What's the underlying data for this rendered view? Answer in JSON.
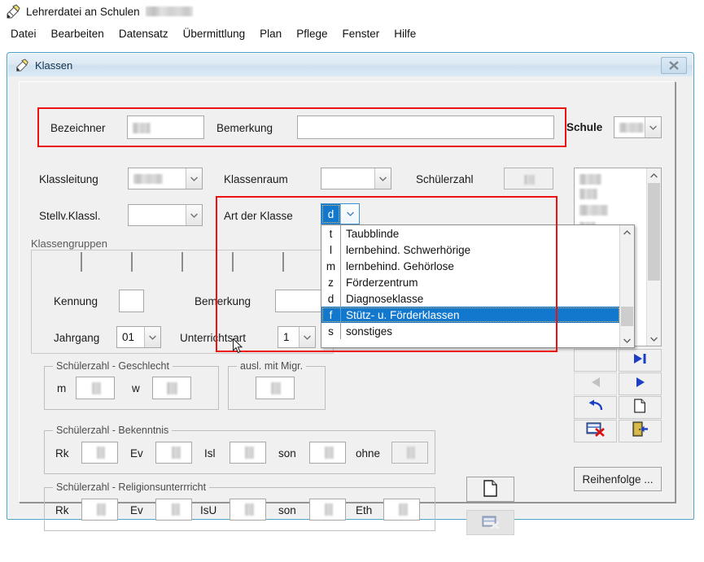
{
  "app": {
    "icon": "pen-document-icon",
    "title": "Lehrerdatei an Schulen",
    "title_redacted": true,
    "menu": [
      "Datei",
      "Bearbeiten",
      "Datensatz",
      "Übermittlung",
      "Plan",
      "Pflege",
      "Fenster",
      "Hilfe"
    ]
  },
  "dialog": {
    "icon": "pen-document-icon",
    "title": "Klassen",
    "close_label": "✕"
  },
  "top_section": {
    "bezeichner_label": "Bezeichner",
    "bezeichner_value": "",
    "bemerkung_label": "Bemerkung",
    "bemerkung_value": "",
    "schule_label": "Schule",
    "schule_value": ""
  },
  "form": {
    "klassleitung_label": "Klassleitung",
    "klassleitung_value": "",
    "klassenraum_label": "Klassenraum",
    "klassenraum_value": "",
    "schuelerzahl_label": "Schülerzahl",
    "schuelerzahl_value": "",
    "stellv_label": "Stellv.Klassl.",
    "stellv_value": "",
    "art_der_klasse_label": "Art der Klasse",
    "art_der_klasse_value": "d"
  },
  "klassengruppen": {
    "title": "Klassengruppen",
    "kennung_label": "Kennung",
    "kennung_value": "",
    "bemerkung_label": "Bemerkung",
    "bemerkung_value": "",
    "jahrgang_label": "Jahrgang",
    "jahrgang_value": "01",
    "unterrichtsart_label": "Unterrichtsart",
    "unterrichtsart_value": "1"
  },
  "geschlecht": {
    "title": "Schülerzahl - Geschlecht",
    "m_label": "m",
    "m_value": "",
    "w_label": "w",
    "w_value": ""
  },
  "migration": {
    "title": "ausl. mit Migr.",
    "value": ""
  },
  "bekenntnis": {
    "title": "Schülerzahl - Bekenntnis",
    "fields": [
      {
        "label": "Rk",
        "value": ""
      },
      {
        "label": "Ev",
        "value": ""
      },
      {
        "label": "Isl",
        "value": ""
      },
      {
        "label": "son",
        "value": ""
      },
      {
        "label": "ohne",
        "value": ""
      }
    ]
  },
  "religionsunterricht": {
    "title": "Schülerzahl - Religionsunterrricht",
    "fields": [
      {
        "label": "Rk",
        "value": ""
      },
      {
        "label": "Ev",
        "value": ""
      },
      {
        "label": "IsU",
        "value": ""
      },
      {
        "label": "son",
        "value": ""
      },
      {
        "label": "Eth",
        "value": ""
      }
    ]
  },
  "art_der_klasse_dropdown": {
    "open": true,
    "selected_key": "f",
    "highlight_color": "#1278ce",
    "options": [
      {
        "key": "t",
        "label": "Taubblinde"
      },
      {
        "key": "l",
        "label": "lernbehind. Schwerhörige"
      },
      {
        "key": "m",
        "label": "lernbehind. Gehörlose"
      },
      {
        "key": "z",
        "label": "Förderzentrum"
      },
      {
        "key": "d",
        "label": "Diagnoseklasse"
      },
      {
        "key": "f",
        "label": "Stütz- u. Förderklassen"
      },
      {
        "key": "s",
        "label": "sonstiges"
      }
    ]
  },
  "record_list": {
    "items": [
      "",
      "",
      "",
      ""
    ]
  },
  "nav_buttons": [
    {
      "name": "last-record-button",
      "icon": "last-record-icon",
      "enabled": true
    },
    {
      "name": "previous-record-button",
      "icon": "previous-arrow-icon",
      "enabled": false
    },
    {
      "name": "next-record-button",
      "icon": "next-arrow-icon",
      "enabled": true
    },
    {
      "name": "undo-button",
      "icon": "undo-arrow-icon",
      "enabled": true
    },
    {
      "name": "new-record-button",
      "icon": "new-document-icon",
      "enabled": true
    },
    {
      "name": "delete-record-button",
      "icon": "delete-record-icon",
      "enabled": true
    },
    {
      "name": "exit-button",
      "icon": "exit-door-icon",
      "enabled": true
    }
  ],
  "center_buttons": [
    {
      "name": "new-entry-button",
      "icon": "new-document-icon",
      "enabled": true
    },
    {
      "name": "delete-entry-button",
      "icon": "delete-record-icon",
      "enabled": false
    }
  ],
  "reihenfolge_button": {
    "label": "Reihenfolge ..."
  },
  "highlights": {
    "color": "#ee1111",
    "regions": [
      "top-identifier-row",
      "art-der-klasse-dropdown"
    ]
  }
}
